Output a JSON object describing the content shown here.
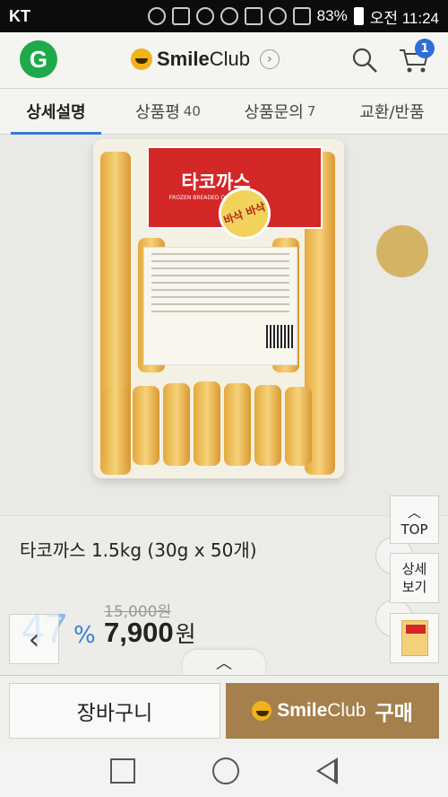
{
  "status_bar": {
    "carrier": "KT",
    "battery": "83%",
    "time": "오전 11:24"
  },
  "header": {
    "logo_letter": "G",
    "brand_bold": "Smile",
    "brand_light": "Club",
    "brand_arrow": "›",
    "cart_count": "1"
  },
  "tabs": [
    {
      "label": "상세설명",
      "count": ""
    },
    {
      "label": "상품평",
      "count": "40"
    },
    {
      "label": "상품문의",
      "count": "7"
    },
    {
      "label": "교환/반품",
      "count": ""
    }
  ],
  "product_image": {
    "package_title": "타코까스",
    "package_subtitle": "FROZEN BREADED OCTOPUS CAKE",
    "badge_text": "바삭 바삭"
  },
  "product": {
    "title": "타코까스 1.5kg (30g x 50개)",
    "discount_value": "47",
    "discount_unit": "%",
    "original_price": "15,000원",
    "price": "7,900",
    "price_unit": "원"
  },
  "side_buttons": {
    "top_arrow": "︿",
    "top_label": "TOP",
    "detail_label_1": "상세",
    "detail_label_2": "보기"
  },
  "nav": {
    "back_arrow": "‹",
    "collapse_arrow": "︿"
  },
  "actions": {
    "cart_label": "장바구니",
    "buy_brand_bold": "Smile",
    "buy_brand_light": "Club",
    "buy_label": "구매"
  },
  "colors": {
    "accent_blue": "#3a7bd5",
    "buy_brown": "#a5804d",
    "gmarket_green": "#1fa94b",
    "package_red": "#d42727"
  }
}
